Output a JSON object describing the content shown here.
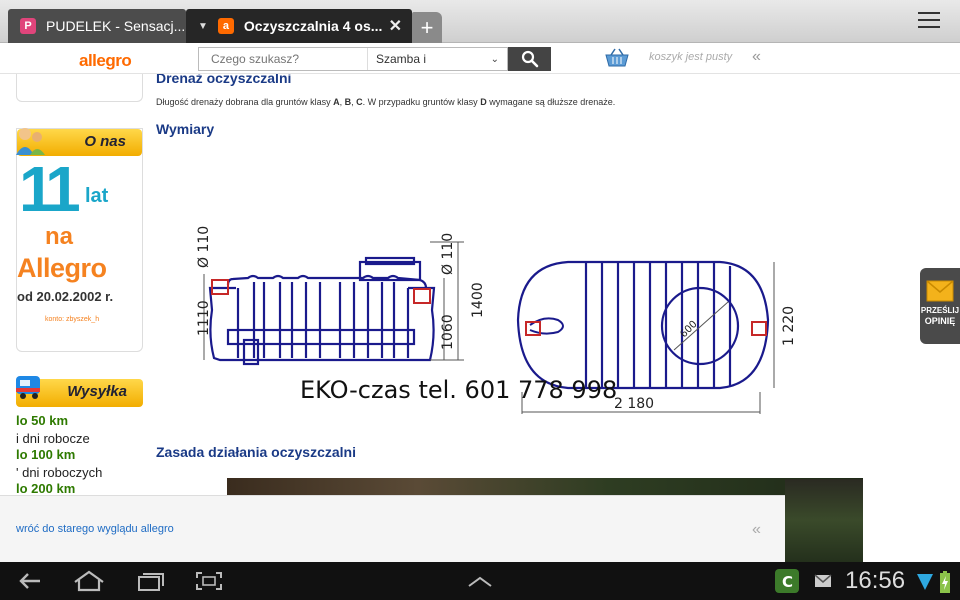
{
  "tabs": [
    {
      "favicon_letter": "P",
      "favicon_color": "#e0457b",
      "title": "PUDELEK - Sensacj..."
    },
    {
      "favicon_letter": "a",
      "favicon_color": "#ff6a00",
      "title": "Oczyszczalnia 4 os..."
    }
  ],
  "new_tab": "+",
  "header": {
    "logo": "allegro",
    "search_placeholder": "Czego szukasz?",
    "search_category": "Szamba i",
    "cart_text": "koszyk jest pusty",
    "collapse": "«"
  },
  "sidebar": {
    "onas_title": "O nas",
    "years": "11",
    "lat": "lat",
    "na": "na",
    "allegro": "Allegro",
    "date": "od 20.02.2002 r.",
    "konto": "konto: zbyszek_h",
    "wysylka_title": "Wysyłka",
    "shipping": [
      {
        "km": "lo 50 km",
        "days": "i dni robocze"
      },
      {
        "km": "lo 100 km",
        "days": "' dni roboczych"
      },
      {
        "km": "lo 200 km"
      }
    ]
  },
  "main": {
    "drenaz_title": "Drenaż oczyszczalni",
    "drenaz_parts": [
      "Długość drenaży dobrana dla gruntów klasy ",
      "A",
      ", ",
      "B",
      ", ",
      "C",
      ". W przypadku gruntów klasy ",
      "D",
      " wymagane są dłuższe drenaże."
    ],
    "wymiary_title": "Wymiary",
    "dims": {
      "d1": "Ø 110",
      "d2": "Ø 110",
      "h1110": "1110",
      "h1060": "1060",
      "h1400": "1400",
      "manhole": "600",
      "w1220": "1 220",
      "w2180": "2 180"
    },
    "phone": "EKO-czas tel. 601 778 998",
    "zasada_title": "Zasada działania oczyszczalni"
  },
  "side_widget": {
    "line1": "PRZEŚLIJ",
    "line2": "OPINIĘ"
  },
  "bottom_bar": {
    "link": "wróć do starego wyglądu allegro",
    "chevrons": "«"
  },
  "system": {
    "time": "16:56"
  },
  "colors": {
    "accent": "#ff6a00",
    "heading": "#1a3a86",
    "drawing": "#1a1a8c",
    "pipe": "#c62828"
  }
}
